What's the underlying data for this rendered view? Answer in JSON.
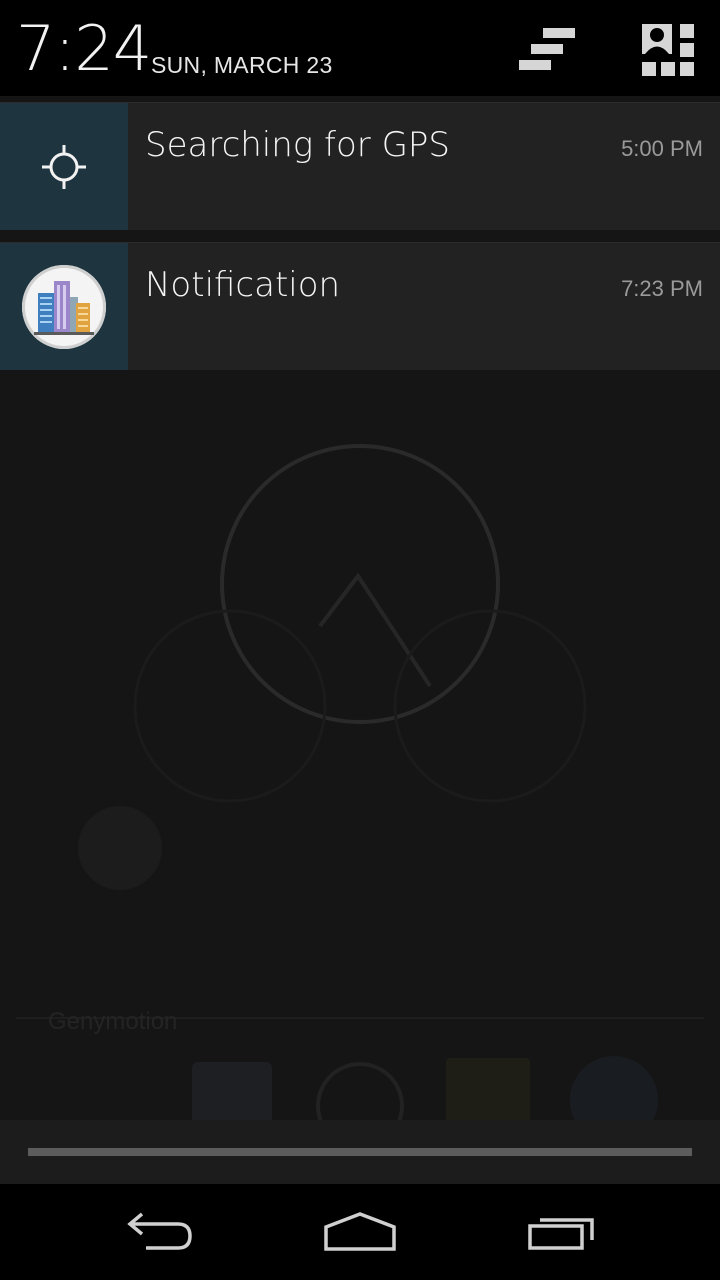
{
  "header": {
    "clock": "7:24",
    "date": "SUN, MARCH 23"
  },
  "icons": {
    "clear_all": "clear-all-icon",
    "quick_settings": "quick-settings-icon",
    "gps": "gps-crosshair-icon",
    "app": "buildings-icon",
    "back": "back-arrow-icon",
    "home": "home-icon",
    "recents": "recent-apps-icon"
  },
  "notifications": [
    {
      "title": "Searching for GPS",
      "time": "5:00 PM"
    },
    {
      "title": "Notification",
      "time": "7:23 PM"
    }
  ],
  "background": {
    "app_label": "Genymotion"
  },
  "colors": {
    "icon_box": "#1e3540",
    "notification_bg": "#222222",
    "handle": "#5c5c5c"
  }
}
